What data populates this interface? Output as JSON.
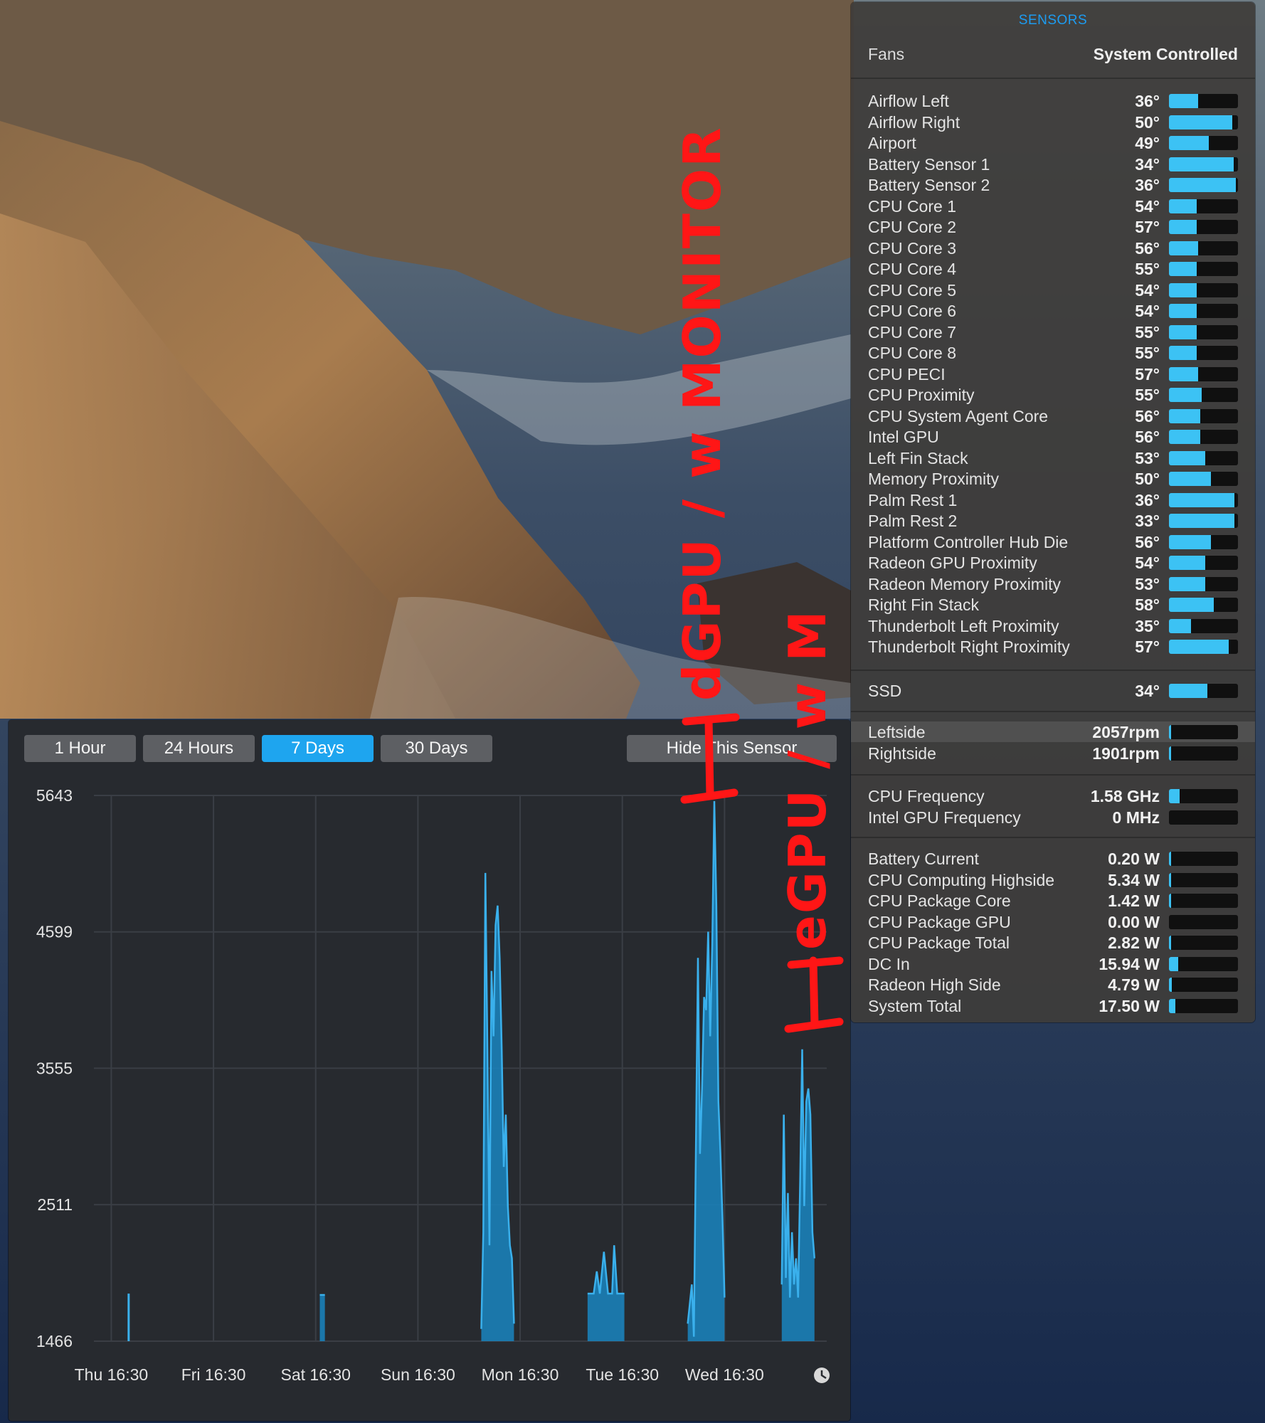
{
  "sensors": {
    "title": "SENSORS",
    "fans_label": "Fans",
    "fans_value": "System Controlled",
    "colors": {
      "accent": "#1c9cf2",
      "bar": "#3cc2f4"
    },
    "temperatures": [
      {
        "name": "Airflow Left",
        "value": "36°",
        "level": 0.42
      },
      {
        "name": "Airflow Right",
        "value": "50°",
        "level": 0.92
      },
      {
        "name": "Airport",
        "value": "49°",
        "level": 0.58
      },
      {
        "name": "Battery Sensor 1",
        "value": "34°",
        "level": 0.94
      },
      {
        "name": "Battery Sensor 2",
        "value": "36°",
        "level": 0.97
      },
      {
        "name": "CPU Core 1",
        "value": "54°",
        "level": 0.4
      },
      {
        "name": "CPU Core 2",
        "value": "57°",
        "level": 0.4
      },
      {
        "name": "CPU Core 3",
        "value": "56°",
        "level": 0.42
      },
      {
        "name": "CPU Core 4",
        "value": "55°",
        "level": 0.4
      },
      {
        "name": "CPU Core 5",
        "value": "54°",
        "level": 0.4
      },
      {
        "name": "CPU Core 6",
        "value": "54°",
        "level": 0.4
      },
      {
        "name": "CPU Core 7",
        "value": "55°",
        "level": 0.4
      },
      {
        "name": "CPU Core 8",
        "value": "55°",
        "level": 0.4
      },
      {
        "name": "CPU PECI",
        "value": "57°",
        "level": 0.42
      },
      {
        "name": "CPU Proximity",
        "value": "55°",
        "level": 0.47
      },
      {
        "name": "CPU System Agent Core",
        "value": "56°",
        "level": 0.45
      },
      {
        "name": "Intel GPU",
        "value": "56°",
        "level": 0.45
      },
      {
        "name": "Left Fin Stack",
        "value": "53°",
        "level": 0.53
      },
      {
        "name": "Memory Proximity",
        "value": "50°",
        "level": 0.61
      },
      {
        "name": "Palm Rest 1",
        "value": "36°",
        "level": 0.95
      },
      {
        "name": "Palm Rest 2",
        "value": "33°",
        "level": 0.95
      },
      {
        "name": "Platform Controller Hub Die",
        "value": "56°",
        "level": 0.61
      },
      {
        "name": "Radeon GPU Proximity",
        "value": "54°",
        "level": 0.53
      },
      {
        "name": "Radeon Memory Proximity",
        "value": "53°",
        "level": 0.53
      },
      {
        "name": "Right Fin Stack",
        "value": "58°",
        "level": 0.65
      },
      {
        "name": "Thunderbolt Left Proximity",
        "value": "35°",
        "level": 0.32
      },
      {
        "name": "Thunderbolt Right Proximity",
        "value": "57°",
        "level": 0.87
      }
    ],
    "ssd": [
      {
        "name": "SSD",
        "value": "34°",
        "level": 0.56
      }
    ],
    "fans": [
      {
        "name": "Leftside",
        "value": "2057rpm",
        "level": 0.03,
        "highlighted": true
      },
      {
        "name": "Rightside",
        "value": "1901rpm",
        "level": 0.03
      }
    ],
    "frequencies": [
      {
        "name": "CPU Frequency",
        "value": "1.58 GHz",
        "level": 0.15
      },
      {
        "name": "Intel GPU Frequency",
        "value": "0 MHz",
        "level": 0
      }
    ],
    "power": [
      {
        "name": "Battery Current",
        "value": "0.20 W",
        "level": 0.02
      },
      {
        "name": "CPU Computing Highside",
        "value": "5.34 W",
        "level": 0.02
      },
      {
        "name": "CPU Package Core",
        "value": "1.42 W",
        "level": 0.02
      },
      {
        "name": "CPU Package GPU",
        "value": "0.00 W",
        "level": 0
      },
      {
        "name": "CPU Package Total",
        "value": "2.82 W",
        "level": 0.02
      },
      {
        "name": "DC In",
        "value": "15.94 W",
        "level": 0.13
      },
      {
        "name": "Radeon High Side",
        "value": "4.79 W",
        "level": 0.04
      },
      {
        "name": "System Total",
        "value": "17.50 W",
        "level": 0.09
      }
    ]
  },
  "history": {
    "ranges": [
      "1 Hour",
      "24 Hours",
      "7 Days",
      "30 Days"
    ],
    "active_range": "7 Days",
    "hide_label": "Hide This Sensor",
    "clock_icon": "clock-icon"
  },
  "chart_data": {
    "type": "area",
    "y_ticks": [
      "5643",
      "4599",
      "3555",
      "2511",
      "1466"
    ],
    "ylim": [
      1466,
      5643
    ],
    "x_ticks": [
      "Thu 16:30",
      "Fri 16:30",
      "Sat 16:30",
      "Sun 16:30",
      "Mon 16:30",
      "Tue 16:30",
      "Wed 16:30"
    ],
    "xlim": [
      -0.17,
      7.0
    ],
    "grid": true,
    "colors": {
      "line": "#3ab0ec",
      "fill": "#1b7fb8"
    },
    "series": [
      {
        "points": [
          [
            0.17,
            1830
          ],
          [
            2.04,
            1820
          ],
          [
            2.09,
            1820
          ],
          [
            3.62,
            1560
          ],
          [
            3.64,
            2300
          ],
          [
            3.66,
            5050
          ],
          [
            3.68,
            3700
          ],
          [
            3.7,
            2200
          ],
          [
            3.72,
            4300
          ],
          [
            3.74,
            3800
          ],
          [
            3.76,
            4650
          ],
          [
            3.78,
            4800
          ],
          [
            3.8,
            4400
          ],
          [
            3.82,
            3700
          ],
          [
            3.84,
            2800
          ],
          [
            3.86,
            3200
          ],
          [
            3.88,
            2500
          ],
          [
            3.9,
            2200
          ],
          [
            3.92,
            2100
          ],
          [
            3.94,
            1600
          ],
          [
            4.66,
            1830
          ],
          [
            4.72,
            1830
          ],
          [
            4.75,
            2000
          ],
          [
            4.78,
            1830
          ],
          [
            4.82,
            2150
          ],
          [
            4.86,
            1830
          ],
          [
            4.9,
            1830
          ],
          [
            4.92,
            2200
          ],
          [
            4.95,
            1830
          ],
          [
            5.02,
            1830
          ],
          [
            5.64,
            1600
          ],
          [
            5.68,
            1900
          ],
          [
            5.7,
            1500
          ],
          [
            5.74,
            4400
          ],
          [
            5.76,
            2900
          ],
          [
            5.78,
            3400
          ],
          [
            5.8,
            4100
          ],
          [
            5.82,
            4000
          ],
          [
            5.84,
            4600
          ],
          [
            5.86,
            3800
          ],
          [
            5.88,
            4500
          ],
          [
            5.9,
            5600
          ],
          [
            5.92,
            4800
          ],
          [
            5.94,
            3300
          ],
          [
            5.96,
            2900
          ],
          [
            5.98,
            2400
          ],
          [
            6.0,
            1800
          ],
          [
            6.56,
            1900
          ],
          [
            6.58,
            3200
          ],
          [
            6.6,
            1950
          ],
          [
            6.62,
            2600
          ],
          [
            6.64,
            1800
          ],
          [
            6.66,
            2300
          ],
          [
            6.68,
            1900
          ],
          [
            6.7,
            2100
          ],
          [
            6.72,
            1800
          ],
          [
            6.74,
            2700
          ],
          [
            6.76,
            3700
          ],
          [
            6.78,
            2500
          ],
          [
            6.8,
            3300
          ],
          [
            6.82,
            3400
          ],
          [
            6.84,
            3200
          ],
          [
            6.86,
            2300
          ],
          [
            6.88,
            2100
          ]
        ]
      }
    ]
  },
  "annotations": {
    "text_1": "dGPU / w MONITOR",
    "text_2": "eGPU / w M"
  }
}
